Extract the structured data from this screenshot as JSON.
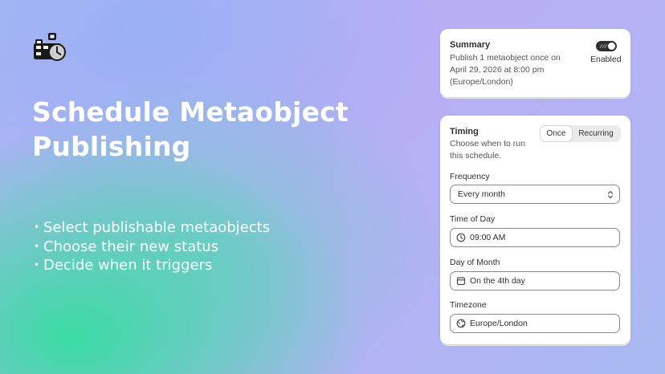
{
  "hero": {
    "title_line1": "Schedule Metaobject",
    "title_line2": "Publishing",
    "bullets": [
      "Select publishable metaobjects",
      "Choose their new status",
      "Decide when it triggers"
    ]
  },
  "summary": {
    "title": "Summary",
    "text": "Publish 1 metaobject once on April 29, 2026 at 8:00 pm (Europe/London)",
    "toggle_label": "Enabled",
    "toggle_on": true
  },
  "timing": {
    "title": "Timing",
    "description": "Choose when to run this schedule.",
    "segments": {
      "once": "Once",
      "recurring": "Recurring",
      "selected": "Once"
    },
    "frequency": {
      "label": "Frequency",
      "value": "Every month"
    },
    "time_of_day": {
      "label": "Time of Day",
      "value": "09:00 AM"
    },
    "day_of_month": {
      "label": "Day of Month",
      "value": "On the 4th day"
    },
    "timezone": {
      "label": "Timezone",
      "value": "Europe/London"
    }
  },
  "icons": {
    "logo": "calendar-clock-icon",
    "time": "clock-icon",
    "day": "calendar-icon",
    "timezone": "globe-icon",
    "select": "chevron-up-down-icon"
  },
  "colors": {
    "text_dark": "#303030",
    "text_muted": "#555555",
    "hero_text": "#ffffff",
    "green": "#34de9e",
    "purple": "#b6b0f5"
  }
}
